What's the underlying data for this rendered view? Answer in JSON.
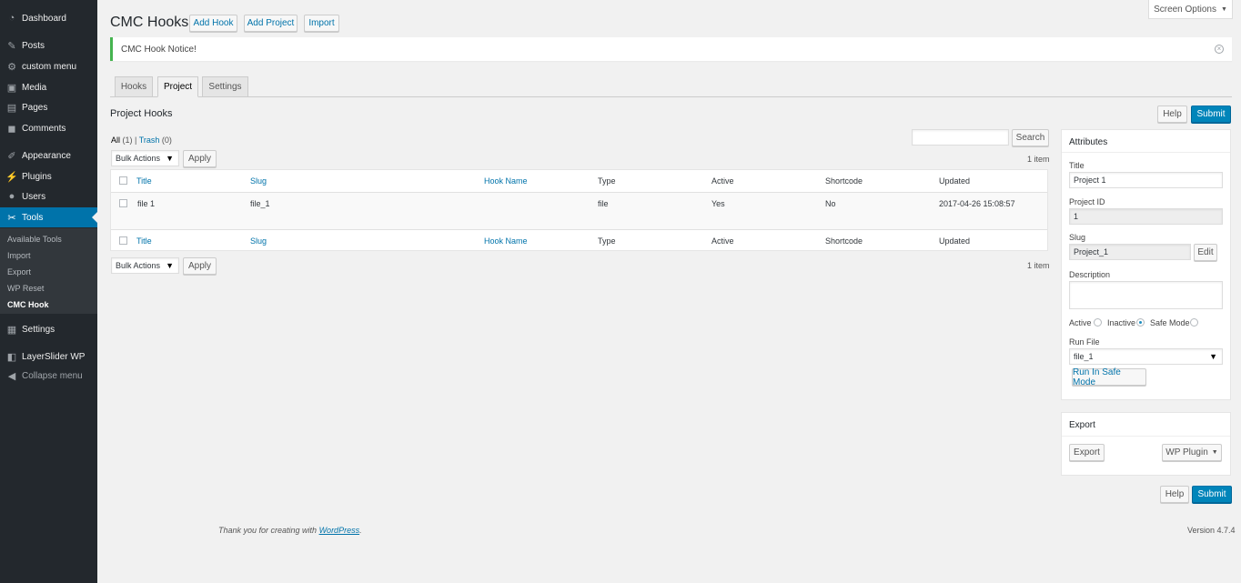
{
  "sidebar": {
    "items": [
      {
        "label": "Dashboard",
        "icon": "dashboard-icon"
      },
      {
        "label": "Posts",
        "icon": "pin-icon"
      },
      {
        "label": "custom menu",
        "icon": "gear-icon"
      },
      {
        "label": "Media",
        "icon": "media-icon"
      },
      {
        "label": "Pages",
        "icon": "page-icon"
      },
      {
        "label": "Comments",
        "icon": "comment-icon"
      },
      {
        "label": "Appearance",
        "icon": "brush-icon"
      },
      {
        "label": "Plugins",
        "icon": "plug-icon"
      },
      {
        "label": "Users",
        "icon": "user-icon"
      },
      {
        "label": "Tools",
        "icon": "wrench-icon"
      },
      {
        "label": "Settings",
        "icon": "settings-icon"
      },
      {
        "label": "LayerSlider WP",
        "icon": "layers-icon"
      },
      {
        "label": "Collapse menu",
        "icon": "collapse-icon"
      }
    ],
    "submenu": [
      "Available Tools",
      "Import",
      "Export",
      "WP Reset",
      "CMC Hook"
    ]
  },
  "header": {
    "title": "CMC Hooks",
    "add_hook": "Add Hook",
    "add_project": "Add Project",
    "import": "Import",
    "screen_options": "Screen Options"
  },
  "notice": {
    "text": "CMC Hook Notice!"
  },
  "tabs": [
    "Hooks",
    "Project",
    "Settings"
  ],
  "section": {
    "title": "Project Hooks"
  },
  "filters": {
    "all_label": "All",
    "all_count": "(1)",
    "sep": "|",
    "trash_label": "Trash",
    "trash_count": "(0)"
  },
  "bulk": {
    "select": "Bulk Actions",
    "apply": "Apply"
  },
  "search": {
    "button": "Search",
    "placeholder": ""
  },
  "items_count": "1 item",
  "table": {
    "columns": [
      "Title",
      "Slug",
      "Hook Name",
      "Type",
      "Active",
      "Shortcode",
      "Updated"
    ],
    "rows": [
      [
        "file 1",
        "file_1",
        "",
        "file",
        "Yes",
        "No",
        "2017-04-26 15:08:57"
      ]
    ]
  },
  "actions": {
    "help": "Help",
    "submit": "Submit"
  },
  "attributes": {
    "title": "Attributes",
    "title_label": "Title",
    "title_value": "Project 1",
    "project_id_label": "Project ID",
    "project_id_value": "1",
    "slug_label": "Slug",
    "slug_value": "Project_1",
    "edit": "Edit",
    "description_label": "Description",
    "description_value": "",
    "status_active": "Active",
    "status_inactive": "Inactive",
    "status_safe": "Safe Mode",
    "status_selected": "Inactive",
    "run_file_label": "Run File",
    "run_file_value": "file_1",
    "run_button": "Run In Safe Mode"
  },
  "export": {
    "title": "Export",
    "button": "Export",
    "format": "WP Plugin"
  },
  "footer": {
    "thanks_prefix": "Thank you for creating with ",
    "wp_link": "WordPress",
    "thanks_suffix": ".",
    "version": "Version 4.7.4"
  },
  "colors": {
    "accent": "#0073aa",
    "primary": "#0085ba",
    "sidebar": "#23282d",
    "notice": "#46b450"
  }
}
